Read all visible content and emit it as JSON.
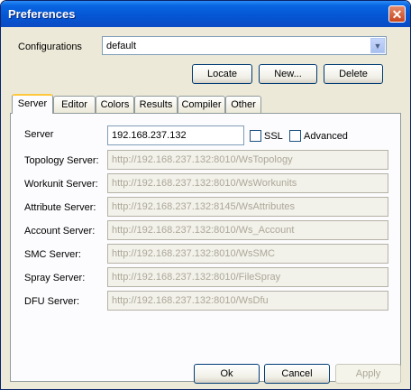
{
  "window": {
    "title": "Preferences",
    "close_label": "✕"
  },
  "configurations": {
    "label": "Configurations",
    "value": "default"
  },
  "buttons": {
    "locate": "Locate",
    "new": "New...",
    "delete": "Delete",
    "ok": "Ok",
    "cancel": "Cancel",
    "apply": "Apply"
  },
  "tabs": [
    "Server",
    "Editor",
    "Colors",
    "Results",
    "Compiler",
    "Other"
  ],
  "server": {
    "label": "Server",
    "value": "192.168.237.132",
    "ssl_label": "SSL",
    "advanced_label": "Advanced"
  },
  "services": [
    {
      "label": "Topology Server:",
      "value": "http://192.168.237.132:8010/WsTopology"
    },
    {
      "label": "Workunit Server:",
      "value": "http://192.168.237.132:8010/WsWorkunits"
    },
    {
      "label": "Attribute Server:",
      "value": "http://192.168.237.132:8145/WsAttributes"
    },
    {
      "label": "Account Server:",
      "value": "http://192.168.237.132:8010/Ws_Account"
    },
    {
      "label": "SMC Server:",
      "value": "http://192.168.237.132:8010/WsSMC"
    },
    {
      "label": "Spray Server:",
      "value": "http://192.168.237.132:8010/FileSpray"
    },
    {
      "label": "DFU Server:",
      "value": "http://192.168.237.132:8010/WsDfu"
    }
  ]
}
